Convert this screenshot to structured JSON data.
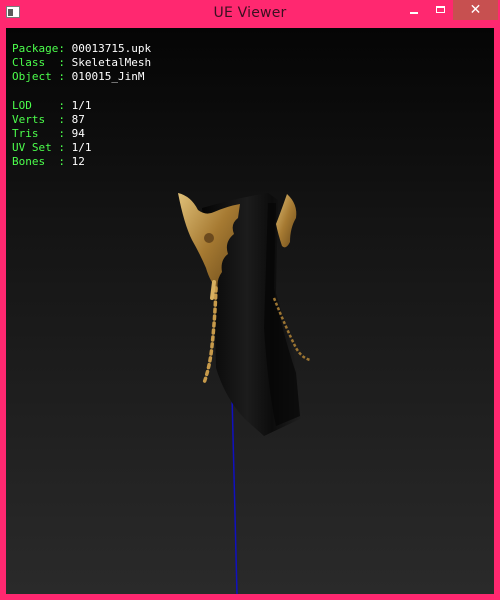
{
  "window": {
    "title": "UE Viewer",
    "controls": {
      "minimize": "minimize",
      "maximize": "maximize",
      "close": "✕"
    }
  },
  "info_group1": [
    {
      "label": "Package:",
      "value": "00013715.upk"
    },
    {
      "label": "Class  :",
      "value": "SkeletalMesh"
    },
    {
      "label": "Object :",
      "value": "010015_JinM"
    }
  ],
  "info_group2": [
    {
      "label": "LOD    :",
      "value": "1/1"
    },
    {
      "label": "Verts  :",
      "value": "87"
    },
    {
      "label": "Tris   :",
      "value": "94"
    },
    {
      "label": "UV Set :",
      "value": "1/1"
    },
    {
      "label": "Bones  :",
      "value": "12"
    }
  ],
  "colors": {
    "window_frame": "#ff2870",
    "close_button": "#c75050",
    "info_label": "#4cff4c",
    "info_value": "#ffffff",
    "mesh_dark": "#0e0e0e",
    "mesh_gold": "#b58a3c",
    "axis_line": "#1010c0"
  }
}
